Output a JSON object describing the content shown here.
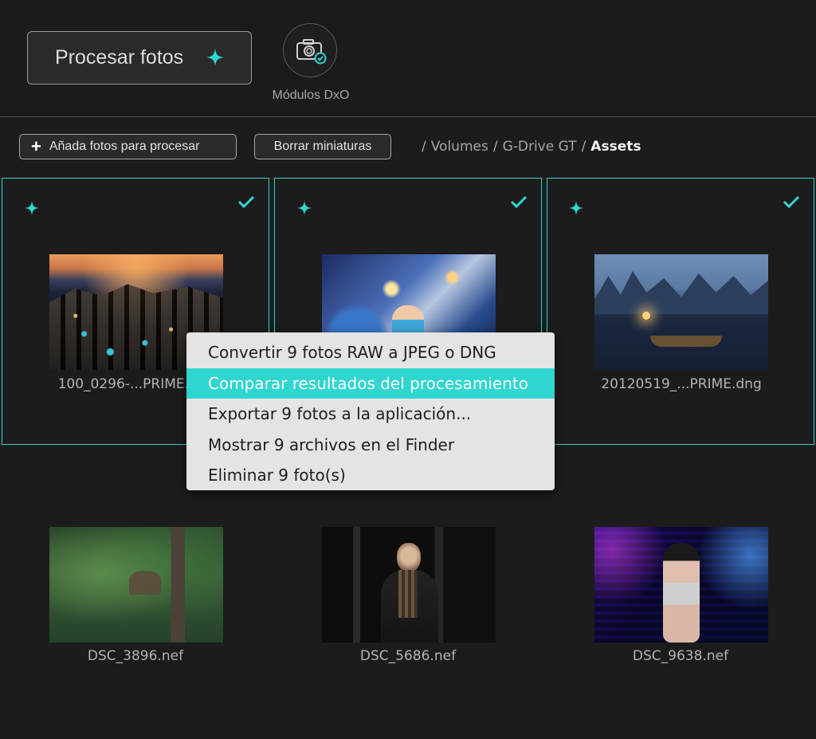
{
  "topbar": {
    "process_label": "Procesar fotos",
    "modules_label": "Módulos DxO"
  },
  "toolbar": {
    "add_label": "Añada fotos para procesar",
    "clear_label": "Borrar miniaturas",
    "breadcrumb": [
      "Volumes",
      "G-Drive GT",
      "Assets"
    ]
  },
  "photos": [
    {
      "filename": "100_0296-...PRIME.dng",
      "selected": true
    },
    {
      "filename": "",
      "selected": true
    },
    {
      "filename": "20120519_...PRIME.dng",
      "selected": true
    },
    {
      "filename": "DSC_3896.nef",
      "selected": false
    },
    {
      "filename": "DSC_5686.nef",
      "selected": false
    },
    {
      "filename": "DSC_9638.nef",
      "selected": false
    }
  ],
  "context_menu": {
    "items": [
      "Convertir 9 fotos RAW a JPEG o DNG",
      "Comparar resultados del procesamiento",
      "Exportar 9 fotos a la aplicación...",
      "Mostrar 9 archivos en el Finder",
      "Eliminar 9 foto(s)"
    ],
    "highlighted_index": 1
  },
  "colors": {
    "accent": "#2fd6cf",
    "background": "#1c1c1c",
    "menu_background": "#e4e4e4"
  },
  "icons": {
    "process": "sparkle-icon",
    "modules": "camera-check-icon",
    "selected": "checkmark-icon"
  }
}
